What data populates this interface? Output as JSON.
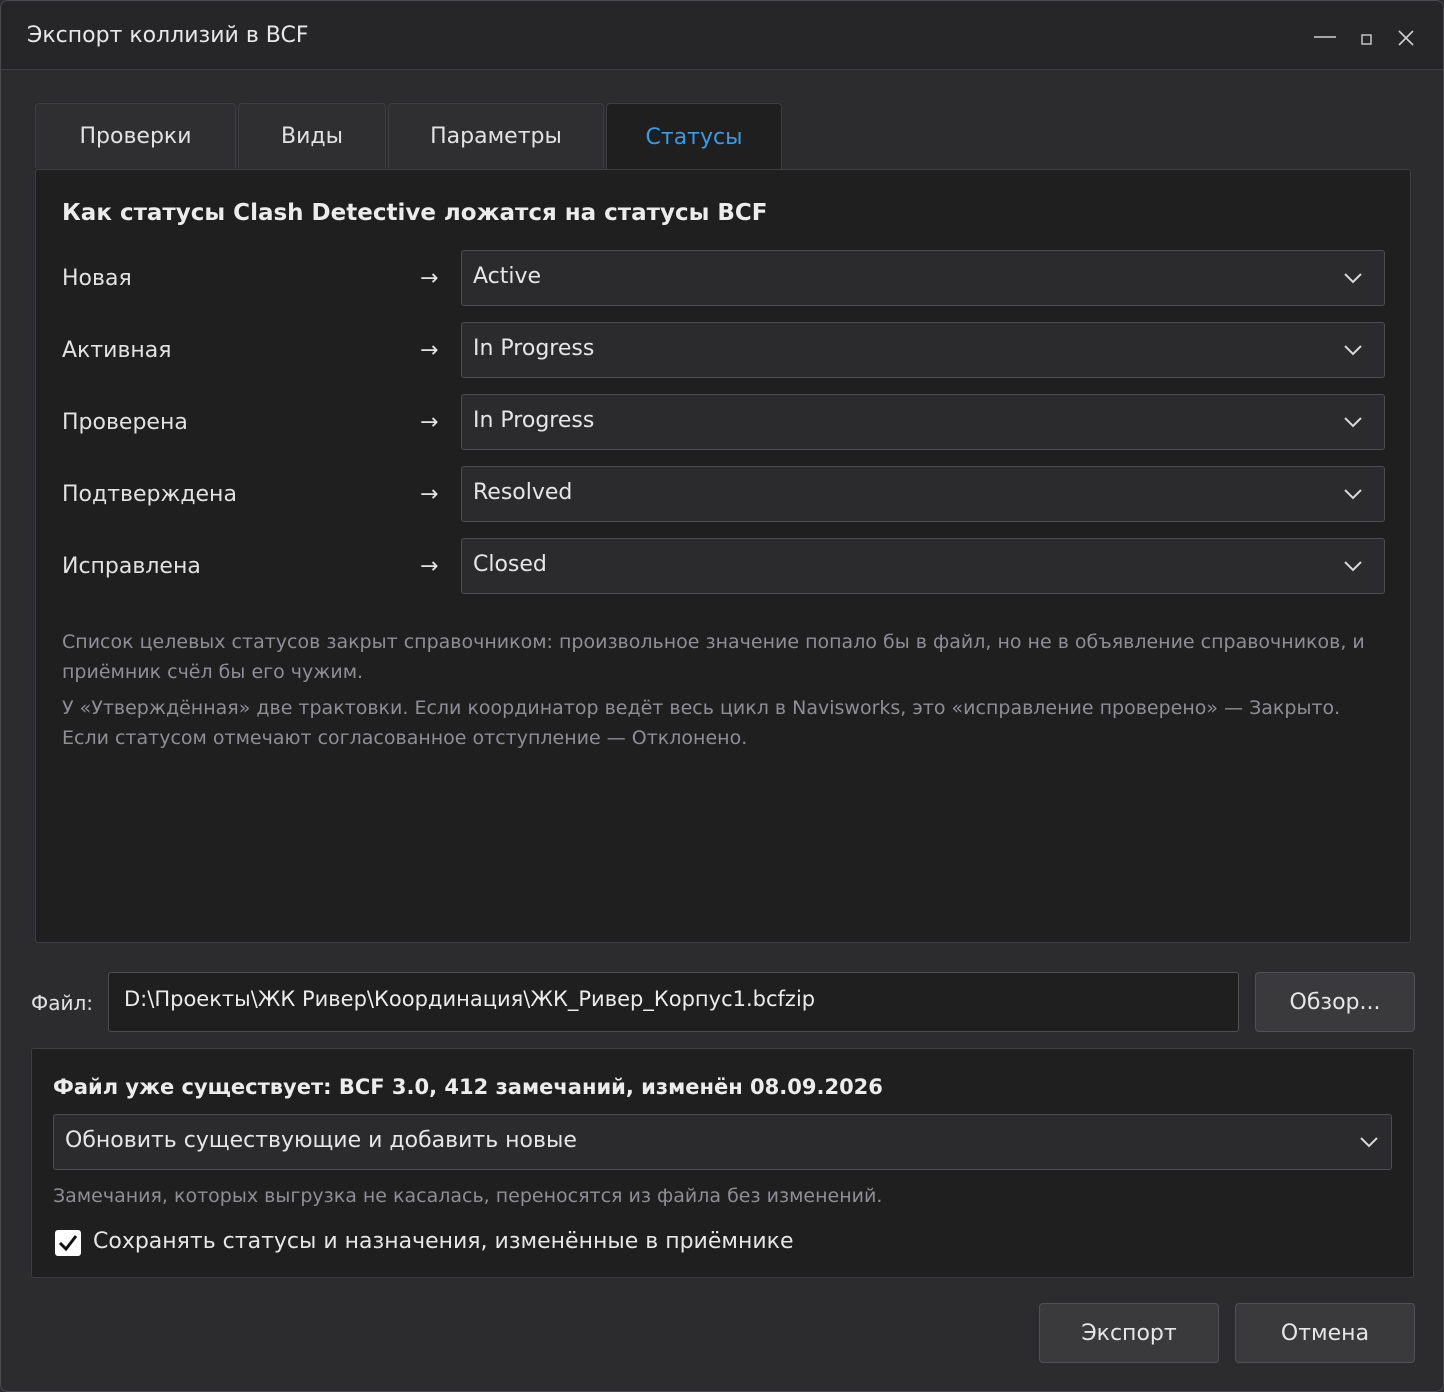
{
  "window": {
    "title": "Экспорт коллизий в BCF",
    "controls": [
      "minimize-icon",
      "maximize-icon",
      "close-icon"
    ]
  },
  "tabs": [
    {
      "label": "Проверки",
      "active": false
    },
    {
      "label": "Виды",
      "active": false
    },
    {
      "label": "Параметры",
      "active": false
    },
    {
      "label": "Статусы",
      "active": true
    }
  ],
  "mapping": {
    "title": "Как статусы Clash Detective ложатся на статусы BCF",
    "arrow": "→",
    "rows": [
      {
        "source": "Новая",
        "target": "Active"
      },
      {
        "source": "Активная",
        "target": "In Progress"
      },
      {
        "source": "Проверена",
        "target": "In Progress"
      },
      {
        "source": "Подтверждена",
        "target": "Resolved"
      },
      {
        "source": "Исправлена",
        "target": "Closed"
      }
    ],
    "note1_line1": "Список целевых статусов закрыт справочником: произвольное значение попало бы в файл, но не в объявление справочников, и",
    "note1_line2": "приёмник счёл бы его чужим.",
    "note2_line1": "У «Утверждённая» две трактовки. Если координатор ведёт весь цикл в Navisworks, это «исправление проверено» — Закрыто.",
    "note2_line2": "Если статусом отмечают согласованное отступление — Отклонено."
  },
  "file": {
    "label": "Файл:",
    "value": "D:\\Проекты\\ЖК Ривер\\Координация\\ЖК_Ривер_Корпус1.bcfzip",
    "browse_label": "Обзор..."
  },
  "existing": {
    "title": "Файл уже существует: BCF 3.0, 412 замечаний, изменён 08.09.2026",
    "mode": "Обновить существующие и добавить новые",
    "note": "Замечания, которых выгрузка не касалась, переносятся из файла без изменений.",
    "keep_label": "Сохранять статусы и назначения, изменённые в приёмнике",
    "keep_checked": true
  },
  "actions": {
    "export_label": "Экспорт",
    "cancel_label": "Отмена"
  },
  "colors": {
    "accent": "#3c9be5",
    "background": "#2c2c2e",
    "panel": "#1f1f20"
  }
}
